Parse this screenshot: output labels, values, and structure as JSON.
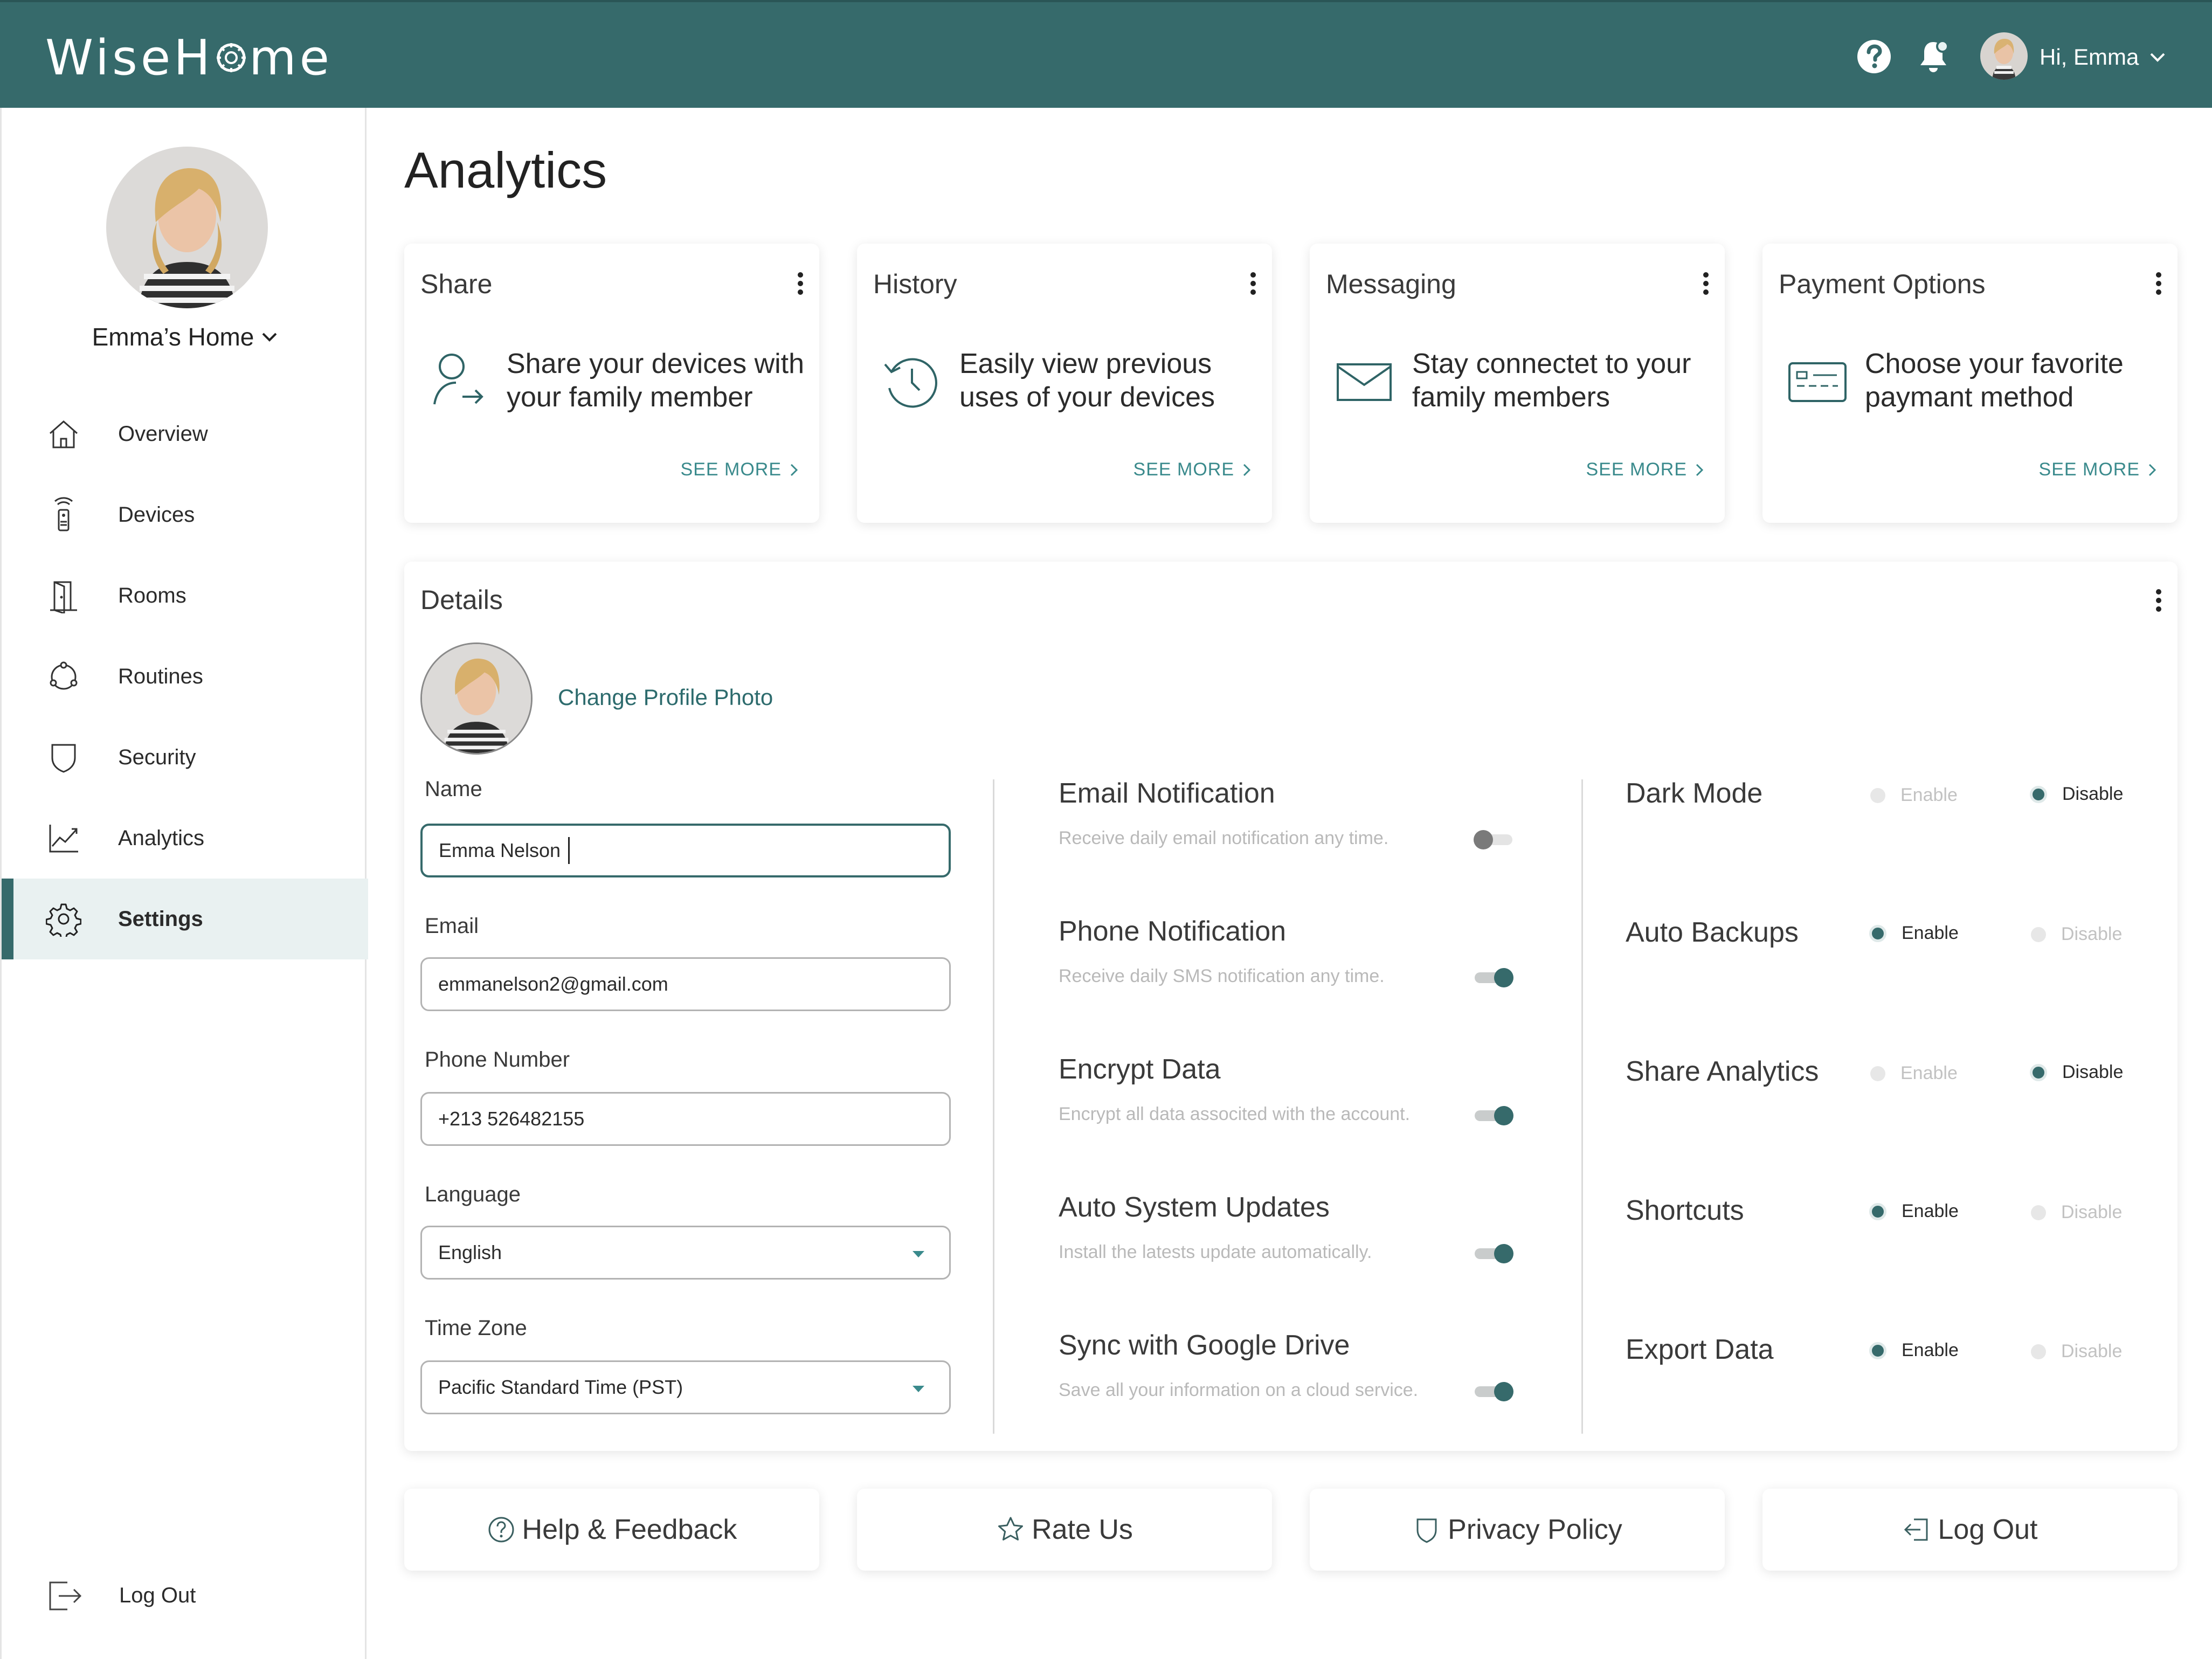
{
  "app": {
    "logo_text_before": "WiseH",
    "logo_text_after": "me"
  },
  "header": {
    "greeting": "Hi, Emma"
  },
  "sidebar": {
    "home_name": "Emma’s Home",
    "items": [
      {
        "label": "Overview",
        "icon": "home-icon"
      },
      {
        "label": "Devices",
        "icon": "remote-icon"
      },
      {
        "label": "Rooms",
        "icon": "door-icon"
      },
      {
        "label": "Routines",
        "icon": "routine-cycle-icon"
      },
      {
        "label": "Security",
        "icon": "shield-icon"
      },
      {
        "label": "Analytics",
        "icon": "chart-line-icon"
      },
      {
        "label": "Settings",
        "icon": "gear-icon",
        "active": true
      }
    ],
    "logout_label": "Log Out"
  },
  "page": {
    "title": "Analytics"
  },
  "cards": [
    {
      "title": "Share",
      "description": "Share your devices with your family member",
      "link": "SEE MORE",
      "icon": "share-user-icon"
    },
    {
      "title": "History",
      "description": "Easily view previous uses of your devices",
      "link": "SEE MORE",
      "icon": "history-clock-icon"
    },
    {
      "title": "Messaging",
      "description": "Stay connectet to your family members",
      "link": "SEE MORE",
      "icon": "envelope-icon"
    },
    {
      "title": "Payment Options",
      "description": "Choose your favorite paymant method",
      "link": "SEE MORE",
      "icon": "payment-card-icon"
    }
  ],
  "details": {
    "title": "Details",
    "change_photo": "Change Profile Photo",
    "fields": {
      "name": {
        "label": "Name",
        "value": "Emma Nelson"
      },
      "email": {
        "label": "Email",
        "value": "emmanelson2@gmail.com"
      },
      "phone": {
        "label": "Phone Number",
        "value": "+213 526482155"
      },
      "language": {
        "label": "Language",
        "value": "English"
      },
      "timezone": {
        "label": "Time Zone",
        "value": "Pacific Standard Time (PST)"
      }
    },
    "toggles": [
      {
        "title": "Email Notification",
        "subtitle": "Receive daily email notification any time.",
        "on": false
      },
      {
        "title": "Phone Notification",
        "subtitle": "Receive daily SMS notification any time.",
        "on": true
      },
      {
        "title": "Encrypt Data",
        "subtitle": "Encrypt all data associted with the account.",
        "on": true
      },
      {
        "title": "Auto System Updates",
        "subtitle": "Install the latests update automatically.",
        "on": true
      },
      {
        "title": "Sync with Google Drive",
        "subtitle": "Save all your information on a cloud service.",
        "on": true
      }
    ],
    "preferences": [
      {
        "title": "Dark Mode",
        "enable": "Enable",
        "disable": "Disable",
        "selected": "disable"
      },
      {
        "title": "Auto Backups",
        "enable": "Enable",
        "disable": "Disable",
        "selected": "enable"
      },
      {
        "title": "Share Analytics",
        "enable": "Enable",
        "disable": "Disable",
        "selected": "disable"
      },
      {
        "title": "Shortcuts",
        "enable": "Enable",
        "disable": "Disable",
        "selected": "enable"
      },
      {
        "title": "Export Data",
        "enable": "Enable",
        "disable": "Disable",
        "selected": "enable"
      }
    ]
  },
  "footer": {
    "help": "Help & Feedback",
    "rate": "Rate Us",
    "privacy": "Privacy Policy",
    "logout": "Log Out"
  },
  "colors": {
    "brand": "#366a6b",
    "accent_link": "#3a8a8c",
    "header_text": "#ffffff"
  }
}
